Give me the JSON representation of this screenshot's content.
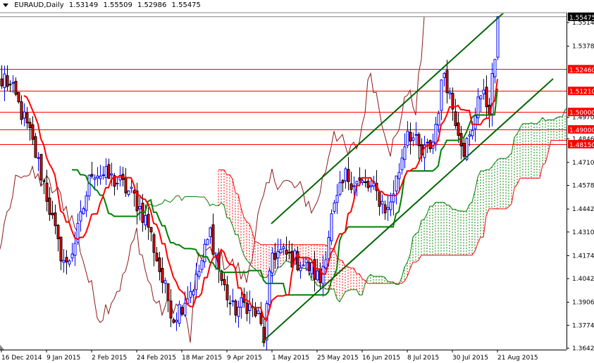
{
  "header": {
    "symbol_tf": "EURAUD,Daily",
    "open": "1.53149",
    "high": "1.55509",
    "low": "1.52986",
    "close": "1.55475"
  },
  "chart_data": {
    "type": "candlestick",
    "title": "EURAUD,Daily",
    "y_range": [
      1.3642,
      1.5604
    ],
    "y_ticks": [
      "1.55140",
      "1.53780",
      "1.49700",
      "1.48460",
      "1.47100",
      "1.45780",
      "1.44420",
      "1.43100",
      "1.41740",
      "1.40420",
      "1.39060",
      "1.37740",
      "1.36420"
    ],
    "x_ticks": [
      {
        "label": "16 Dec 2014",
        "bar": 0
      },
      {
        "label": "9 Jan 2015",
        "bar": 16
      },
      {
        "label": "2 Feb 2015",
        "bar": 32
      },
      {
        "label": "24 Feb 2015",
        "bar": 48
      },
      {
        "label": "18 Mar 2015",
        "bar": 64
      },
      {
        "label": "9 Apr 2015",
        "bar": 80
      },
      {
        "label": "1 May 2015",
        "bar": 96
      },
      {
        "label": "25 May 2015",
        "bar": 112
      },
      {
        "label": "16 Jun 2015",
        "bar": 128
      },
      {
        "label": "8 Jul 2015",
        "bar": 144
      },
      {
        "label": "30 Jul 2015",
        "bar": 160
      },
      {
        "label": "21 Aug 2015",
        "bar": 176
      }
    ],
    "current_price": "1.55475",
    "levels": [
      "1.52460",
      "1.51210",
      "1.50000",
      "1.49000",
      "1.48150"
    ],
    "close_waypoints": [
      [
        0,
        1.515
      ],
      [
        1,
        1.52
      ],
      [
        5,
        1.508
      ],
      [
        10,
        1.487
      ],
      [
        15,
        1.459
      ],
      [
        20,
        1.423
      ],
      [
        23,
        1.411
      ],
      [
        27,
        1.431
      ],
      [
        32,
        1.467
      ],
      [
        37,
        1.463
      ],
      [
        42,
        1.459
      ],
      [
        47,
        1.451
      ],
      [
        52,
        1.435
      ],
      [
        57,
        1.403
      ],
      [
        61,
        1.382
      ],
      [
        64,
        1.39
      ],
      [
        69,
        1.403
      ],
      [
        74,
        1.431
      ],
      [
        78,
        1.403
      ],
      [
        82,
        1.386
      ],
      [
        87,
        1.39
      ],
      [
        91,
        1.382
      ],
      [
        93,
        1.37
      ],
      [
        96,
        1.419
      ],
      [
        99,
        1.419
      ],
      [
        104,
        1.415
      ],
      [
        109,
        1.411
      ],
      [
        113,
        1.403
      ],
      [
        117,
        1.439
      ],
      [
        122,
        1.463
      ],
      [
        127,
        1.459
      ],
      [
        132,
        1.455
      ],
      [
        137,
        1.443
      ],
      [
        141,
        1.467
      ],
      [
        144,
        1.491
      ],
      [
        149,
        1.475
      ],
      [
        153,
        1.483
      ],
      [
        157,
        1.524
      ],
      [
        160,
        1.503
      ],
      [
        164,
        1.479
      ],
      [
        167,
        1.487
      ],
      [
        169,
        1.512
      ],
      [
        173,
        1.503
      ],
      [
        175,
        1.532
      ],
      [
        176,
        1.55475
      ]
    ],
    "trendlines": [
      {
        "name": "upper-channel",
        "from": [
          95.75,
          1.4358
        ],
        "to": [
          178.25,
          1.5571
        ]
      },
      {
        "name": "lower-channel",
        "from": [
          92.5,
          1.3678
        ],
        "to": [
          195.75,
          1.5191
        ]
      }
    ],
    "ichimoku": {
      "tenkan": 9,
      "kijun": 26,
      "senkou_b": 52
    },
    "colors": {
      "bull": "#0000ff",
      "bear_body": "#ff0000",
      "tenkan": "#ff0000",
      "kijun": "#008000",
      "chikou": "#8b1a1a",
      "cloud_up": "#008000",
      "cloud_down": "#ff0000",
      "channel": "#006400",
      "level": "#ff0000",
      "current": "#808080"
    }
  }
}
